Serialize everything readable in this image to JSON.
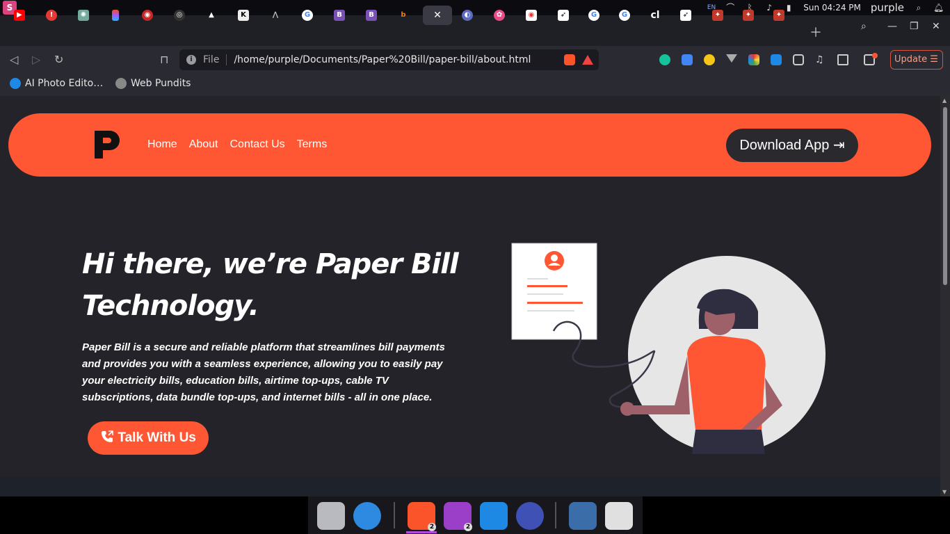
{
  "system": {
    "lang": "EN",
    "clock": "Sun 04:24 PM",
    "user": "purple"
  },
  "browser": {
    "address": {
      "scheme": "File",
      "path": "/home/purple/Documents/Paper%20Bill/paper-bill/about.html"
    },
    "update_label": "Update",
    "update_menu_icon": "☰",
    "bookmarks": [
      {
        "label": "AI Photo Edito…",
        "icon": "ai-photo-icon"
      },
      {
        "label": "Web Pundits",
        "icon": "globe-icon"
      }
    ],
    "tab_icons": [
      "youtube",
      "alert",
      "chatgpt",
      "figma",
      "game",
      "github",
      "vercel",
      "kite",
      "mountain",
      "google",
      "bootstrap",
      "bootstrap",
      "b-orange",
      "active",
      "orbit",
      "dribbble",
      "youtube-red",
      "notion-bird",
      "google",
      "google",
      "cl",
      "bird",
      "ninja",
      "ninja",
      "ninja"
    ]
  },
  "page": {
    "nav": {
      "links": [
        "Home",
        "About",
        "Contact Us",
        "Terms"
      ],
      "download_label": "Download App",
      "download_icon": "⇥"
    },
    "hero": {
      "title_line1": "Hi there, we’re Paper Bill",
      "title_line2": "Technology.",
      "description": "Paper Bill is a secure and reliable platform that streamlines bill payments and provides you with a seamless experience, allowing you to easily pay your electricity bills, education bills, airtime top-ups, cable TV subscriptions, data bundle top-ups, and internet bills - all in one place.",
      "cta_label": "Talk With Us",
      "cta_icon": "phone-icon"
    }
  },
  "colors": {
    "accent": "#ff5733",
    "background": "#242329",
    "button_dark": "#2a2a2e"
  },
  "dock": {
    "badges": [
      "2",
      "2"
    ]
  }
}
